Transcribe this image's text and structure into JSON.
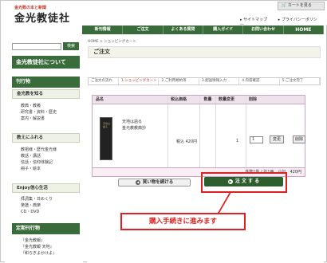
{
  "header": {
    "tagline": "金光数の本と新聞",
    "logo": "金光教徒社",
    "cart_button": "カートを見る",
    "links": [
      "サイトマップ",
      "プライバシーポリシー"
    ]
  },
  "nav": {
    "items": [
      "新刊情報",
      "ご注文",
      "よくある質問",
      "購入ガイド",
      "お問い合わせ",
      "HOME"
    ]
  },
  "sidebar": {
    "search_button": "検索",
    "banner": "金光教徒社について",
    "section_title": "刊行物",
    "groups": [
      {
        "title": "金光教を知る",
        "links": [
          "教典・教義",
          "研究書・資料・歴史",
          "案内・解説書"
        ]
      },
      {
        "title": "教えにふれる",
        "links": [
          "教祖様・歴代金光様",
          "教話・講話",
          "信話・信仰体験記",
          "冊子・絵本"
        ]
      },
      {
        "title": "Enjoy信心生活",
        "links": [
          "拝詞集・日めくり",
          "楽譜・典楽",
          "CD・DVD"
        ]
      }
    ],
    "section2_title": "定期刊行物",
    "periodicals": [
      "『金光教報』",
      "『金光教報 天地』",
      "『和らぎよかけよ』"
    ]
  },
  "main": {
    "breadcrumb": "HOME > ショッピングカート",
    "title": "ご注文",
    "steps": [
      "ご注文の流れ",
      "1.ショッピングカート",
      "2.ご利用規約等",
      "3.配送情報入力",
      "4.内容確認",
      "5.ご注文完了"
    ],
    "table": {
      "headers": [
        "品名",
        "税込価格",
        "数量",
        "数量変更",
        "削除"
      ],
      "item": {
        "name_line1": "天地は語る",
        "name_line2": "金光教教典抄",
        "cover_text": "天地は語る",
        "price": "税込 420円",
        "quantity": "1",
        "quantity_input": "1",
        "change_label": "変更",
        "delete_label": "削除"
      },
      "total": "件数1件 / 計1冊　小計　420円"
    },
    "continue_button": "買い物を続ける",
    "order_button": "注 文 す る",
    "callout": "購入手続きに進みます"
  }
}
